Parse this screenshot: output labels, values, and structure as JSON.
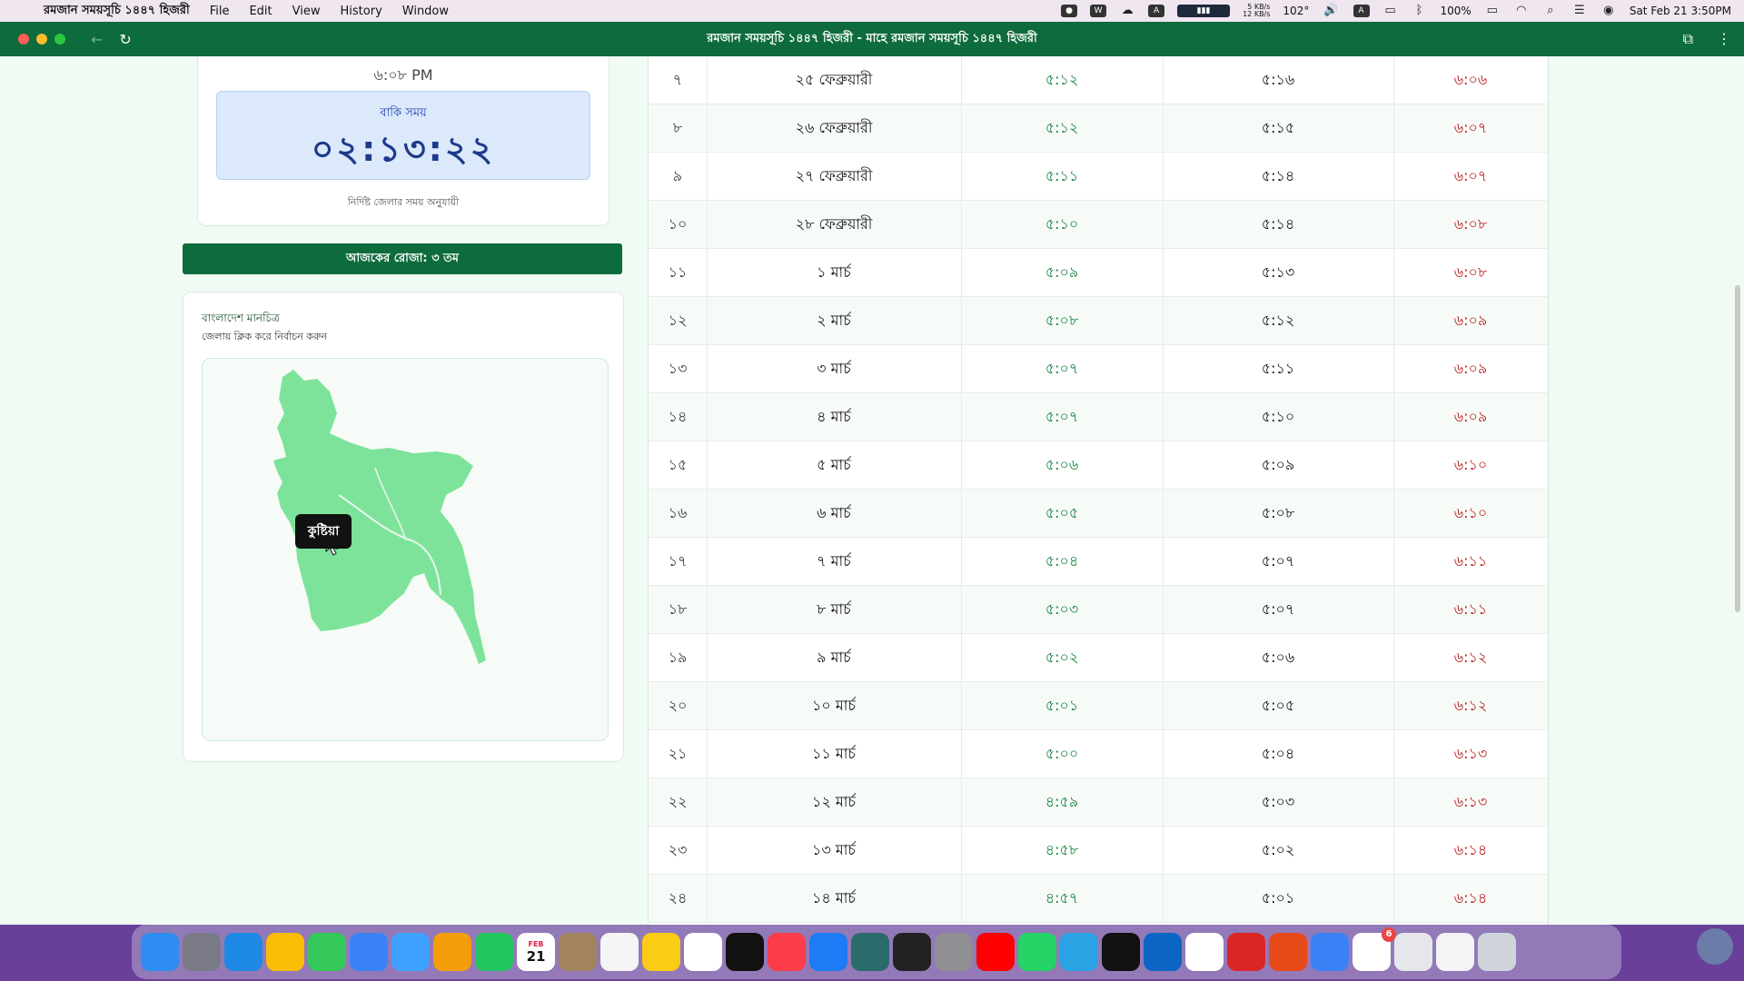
{
  "menubar": {
    "app_name": "রমজান সময়সূচি ১৪৪৭ হিজরী",
    "menus": [
      "File",
      "Edit",
      "View",
      "History",
      "Window"
    ],
    "net_up": "5 KB/s",
    "net_down": "12 KB/s",
    "temperature": "102°",
    "battery": "100%",
    "datetime": "Sat Feb 21  3:50PM"
  },
  "window": {
    "title": "রমজান সময়সূচি ১৪৪৭ হিজরী - মাহে রমজান সময়সূচি ১৪৪৭ হিজরী"
  },
  "countdown": {
    "time": "৬:০৮ PM",
    "label": "বাকি সময়",
    "value": "০২:১৩:২২",
    "note": "নির্দিষ্ট জেলার সময় অনুযায়ী"
  },
  "roza_today": "আজকের রোজা: ৩ তম",
  "map": {
    "title": "বাংলাদেশ মানচিত্র",
    "subtitle": "জেলায় ক্লিক করে নির্বাচন করুন",
    "tooltip": "কুষ্টিয়া",
    "fill_color": "#7ee39a",
    "selected_color": "#166534"
  },
  "schedule": [
    {
      "num": "৭",
      "date": "২৫ ফেব্রুয়ারী",
      "sehri": "৫:১২",
      "fajr": "৫:১৬",
      "iftar": "৬:০৬"
    },
    {
      "num": "৮",
      "date": "২৬ ফেব্রুয়ারী",
      "sehri": "৫:১২",
      "fajr": "৫:১৫",
      "iftar": "৬:০৭"
    },
    {
      "num": "৯",
      "date": "২৭ ফেব্রুয়ারী",
      "sehri": "৫:১১",
      "fajr": "৫:১৪",
      "iftar": "৬:০৭"
    },
    {
      "num": "১০",
      "date": "২৮ ফেব্রুয়ারী",
      "sehri": "৫:১০",
      "fajr": "৫:১৪",
      "iftar": "৬:০৮"
    },
    {
      "num": "১১",
      "date": "১ মার্চ",
      "sehri": "৫:০৯",
      "fajr": "৫:১৩",
      "iftar": "৬:০৮"
    },
    {
      "num": "১২",
      "date": "২ মার্চ",
      "sehri": "৫:০৮",
      "fajr": "৫:১২",
      "iftar": "৬:০৯"
    },
    {
      "num": "১৩",
      "date": "৩ মার্চ",
      "sehri": "৫:০৭",
      "fajr": "৫:১১",
      "iftar": "৬:০৯"
    },
    {
      "num": "১৪",
      "date": "৪ মার্চ",
      "sehri": "৫:০৭",
      "fajr": "৫:১০",
      "iftar": "৬:০৯"
    },
    {
      "num": "১৫",
      "date": "৫ মার্চ",
      "sehri": "৫:০৬",
      "fajr": "৫:০৯",
      "iftar": "৬:১০"
    },
    {
      "num": "১৬",
      "date": "৬ মার্চ",
      "sehri": "৫:০৫",
      "fajr": "৫:০৮",
      "iftar": "৬:১০"
    },
    {
      "num": "১৭",
      "date": "৭ মার্চ",
      "sehri": "৫:০৪",
      "fajr": "৫:০৭",
      "iftar": "৬:১১"
    },
    {
      "num": "১৮",
      "date": "৮ মার্চ",
      "sehri": "৫:০৩",
      "fajr": "৫:০৭",
      "iftar": "৬:১১"
    },
    {
      "num": "১৯",
      "date": "৯ মার্চ",
      "sehri": "৫:০২",
      "fajr": "৫:০৬",
      "iftar": "৬:১২"
    },
    {
      "num": "২০",
      "date": "১০ মার্চ",
      "sehri": "৫:০১",
      "fajr": "৫:০৫",
      "iftar": "৬:১২"
    },
    {
      "num": "২১",
      "date": "১১ মার্চ",
      "sehri": "৫:০০",
      "fajr": "৫:০৪",
      "iftar": "৬:১৩"
    },
    {
      "num": "২২",
      "date": "১২ মার্চ",
      "sehri": "৪:৫৯",
      "fajr": "৫:০৩",
      "iftar": "৬:১৩"
    },
    {
      "num": "২৩",
      "date": "১৩ মার্চ",
      "sehri": "৪:৫৮",
      "fajr": "৫:০২",
      "iftar": "৬:১৪"
    },
    {
      "num": "২৪",
      "date": "১৪ মার্চ",
      "sehri": "৪:৫৭",
      "fajr": "৫:০১",
      "iftar": "৬:১৪"
    }
  ],
  "dock": {
    "icons": [
      "finder-icon",
      "launchpad-icon",
      "safari-icon",
      "chrome-icon",
      "messages-icon",
      "mail-icon",
      "maps-icon",
      "photos-icon",
      "facetime-icon",
      "calendar-icon",
      "contacts-icon",
      "reminders-icon",
      "notes-icon",
      "freeform-icon",
      "tv-icon",
      "music-icon",
      "appstore-icon",
      "quran-icon",
      "terminal-icon",
      "settings-icon",
      "youtube-icon",
      "whatsapp-icon",
      "telegram-icon",
      "app-icon",
      "vscode-icon",
      "app-icon",
      "app-icon",
      "wps-icon",
      "preview-icon",
      "store-icon",
      "file-icon",
      "file-icon",
      "trash-icon"
    ],
    "colors": [
      "#2f8cf0",
      "#7a7a86",
      "#1e88e5",
      "#fbbc05",
      "#34c759",
      "#3b82f6",
      "#3fa1ff",
      "#f59e0b",
      "#22c55e",
      "#ffffff",
      "#a1835e",
      "#f5f5f5",
      "#facc15",
      "#ffffff",
      "#111111",
      "#fb3c4a",
      "#1d7bf5",
      "#2b6b6b",
      "#222222",
      "#8e8e93",
      "#ff0000",
      "#25d366",
      "#2aa3e4",
      "#111111",
      "#0a66c2",
      "#ffffff",
      "#dc2626",
      "#e64a19",
      "#3b82f6",
      "#ffffff",
      "#e5e7eb",
      "#f3f4f6",
      "#d1d5db"
    ],
    "calendar_month": "FEB",
    "calendar_day": "21",
    "badge": "6"
  }
}
